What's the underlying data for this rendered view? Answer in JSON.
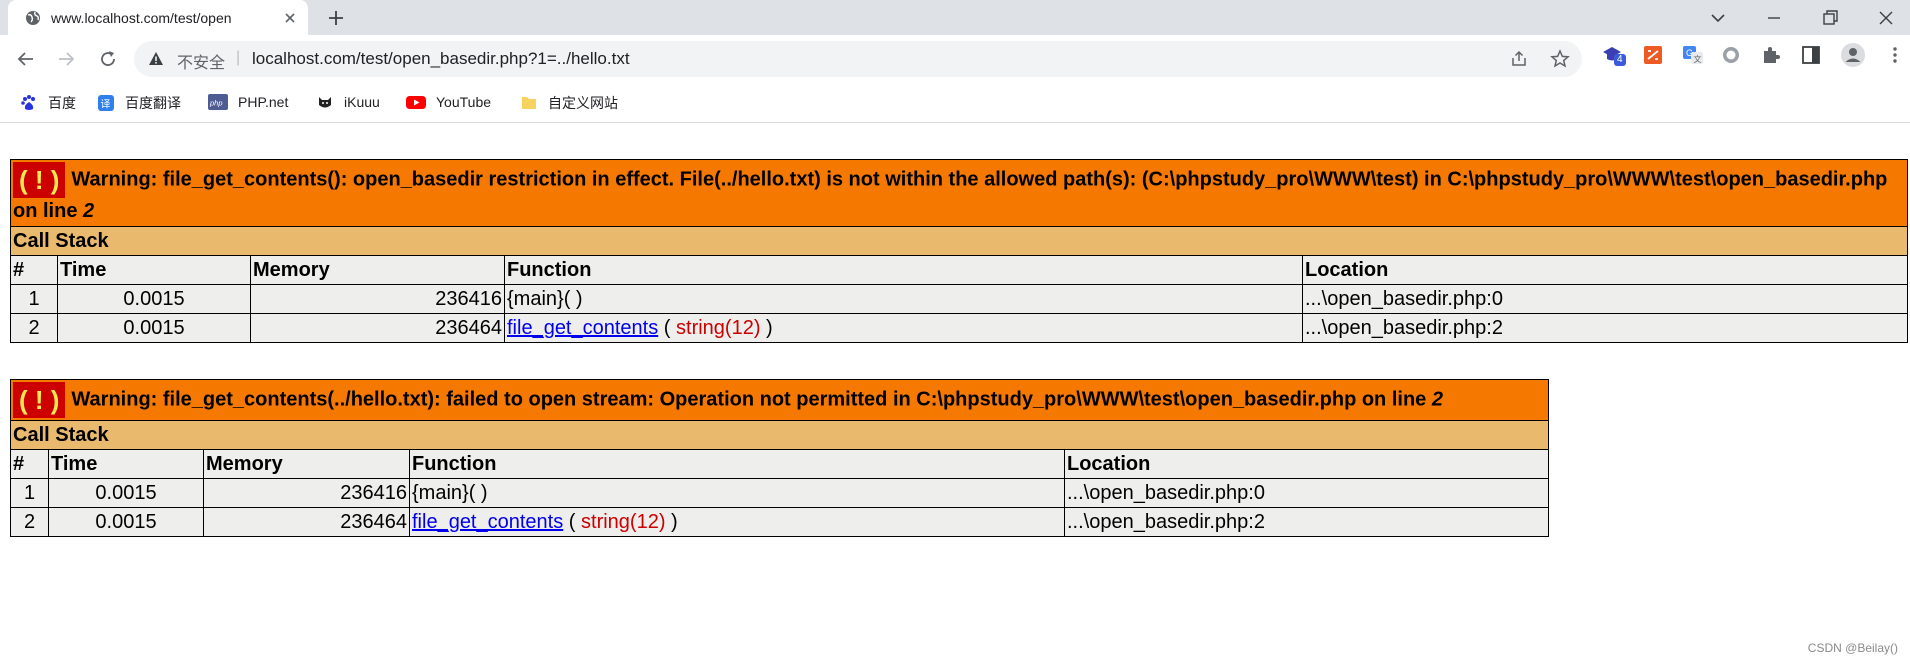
{
  "browser": {
    "tab_title": "www.localhost.com/test/open",
    "insecure_label": "不安全",
    "separator": "|",
    "url": "localhost.com/test/open_basedir.php?1=../hello.txt",
    "extension_badge": "4",
    "bookmarks": [
      {
        "label": "百度",
        "icon": "baidu-paw-icon"
      },
      {
        "label": "百度翻译",
        "icon": "translate-icon"
      },
      {
        "label": "PHP.net",
        "icon": "php-icon"
      },
      {
        "label": "iKuuu",
        "icon": "cat-icon"
      },
      {
        "label": "YouTube",
        "icon": "youtube-icon"
      },
      {
        "label": "自定义网站",
        "icon": "folder-icon"
      }
    ]
  },
  "errors": [
    {
      "bang": "( ! )",
      "message_main": "Warning: file_get_contents(): open_basedir restriction in effect. File(../hello.txt) is not within the allowed path(s): (C:\\phpstudy_pro\\WWW\\test) in C:\\phpstudy_pro\\WWW\\test\\open_basedir.php on line ",
      "line": "2",
      "call_stack_title": "Call Stack",
      "columns": [
        "#",
        "Time",
        "Memory",
        "Function",
        "Location"
      ],
      "rows": [
        {
          "num": "1",
          "time": "0.0015",
          "memory": "236416",
          "function": "{main}( )",
          "args": "",
          "location": "...\\open_basedir.php:0"
        },
        {
          "num": "2",
          "time": "0.0015",
          "memory": "236464",
          "function": "file_get_contents",
          "args": "string(12)",
          "location": "...\\open_basedir.php:2"
        }
      ]
    },
    {
      "bang": "( ! )",
      "message_main": "Warning: file_get_contents(../hello.txt): failed to open stream: Operation not permitted in C:\\phpstudy_pro\\WWW\\test\\open_basedir.php on line ",
      "line": "2",
      "call_stack_title": "Call Stack",
      "columns": [
        "#",
        "Time",
        "Memory",
        "Function",
        "Location"
      ],
      "rows": [
        {
          "num": "1",
          "time": "0.0015",
          "memory": "236416",
          "function": "{main}( )",
          "args": "",
          "location": "...\\open_basedir.php:0"
        },
        {
          "num": "2",
          "time": "0.0015",
          "memory": "236464",
          "function": "file_get_contents",
          "args": "string(12)",
          "location": "...\\open_basedir.php:2"
        }
      ]
    }
  ],
  "watermark": "CSDN @Beilay()"
}
